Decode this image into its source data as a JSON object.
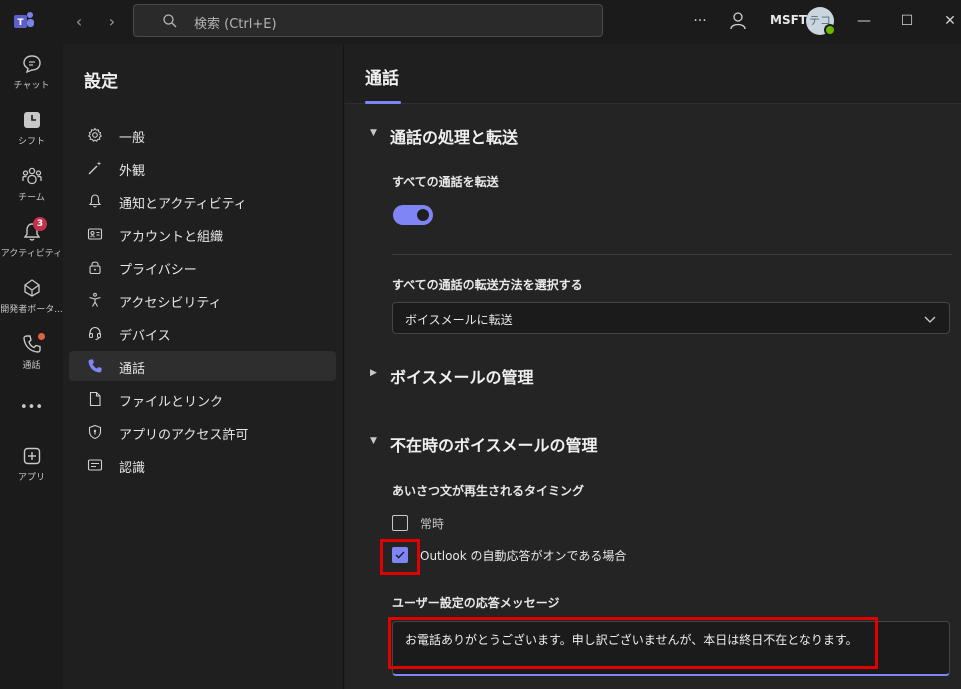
{
  "titlebar": {
    "search_placeholder": "検索 (Ctrl+E)",
    "org_name": "MSFT",
    "avatar_initials": "テコ",
    "more_icon": "ellipsis-icon",
    "minimize": "—",
    "maximize": "☐",
    "close": "✕"
  },
  "rail": {
    "items": [
      {
        "label": "チャット",
        "icon": "chat-icon"
      },
      {
        "label": "シフト",
        "icon": "shifts-icon"
      },
      {
        "label": "チーム",
        "icon": "teams-icon"
      },
      {
        "label": "アクティビティ",
        "icon": "bell-icon",
        "badge": "3"
      },
      {
        "label": "開発者ポータ...",
        "icon": "developer-portal-icon"
      },
      {
        "label": "通話",
        "icon": "phone-icon"
      },
      {
        "label": "•••",
        "icon": "more-apps-icon"
      },
      {
        "label": "アプリ",
        "icon": "add-apps-icon"
      }
    ]
  },
  "settings": {
    "title": "設定",
    "items": [
      {
        "label": "一般",
        "icon": "gear-icon"
      },
      {
        "label": "外観",
        "icon": "wand-icon"
      },
      {
        "label": "通知とアクティビティ",
        "icon": "bell-icon"
      },
      {
        "label": "アカウントと組織",
        "icon": "contact-card-icon"
      },
      {
        "label": "プライバシー",
        "icon": "lock-icon"
      },
      {
        "label": "アクセシビリティ",
        "icon": "accessibility-icon"
      },
      {
        "label": "デバイス",
        "icon": "headset-icon"
      },
      {
        "label": "通話",
        "icon": "phone-icon",
        "active": true
      },
      {
        "label": "ファイルとリンク",
        "icon": "document-icon"
      },
      {
        "label": "アプリのアクセス許可",
        "icon": "shield-icon"
      },
      {
        "label": "認識",
        "icon": "text-card-icon"
      }
    ]
  },
  "main": {
    "title": "通話",
    "section1": {
      "heading": "通話の処理と転送",
      "forward_all_label": "すべての通話を転送",
      "forward_all_on": true,
      "forward_method_label": "すべての通話の転送方法を選択する",
      "forward_method_value": "ボイスメールに転送"
    },
    "section2": {
      "heading": "ボイスメールの管理"
    },
    "section3": {
      "heading": "不在時のボイスメールの管理",
      "timing_label": "あいさつ文が再生されるタイミング",
      "option_always": "常時",
      "option_always_checked": false,
      "option_outlook": "Outlook の自動応答がオンである場合",
      "option_outlook_checked": true,
      "message_label": "ユーザー設定の応答メッセージ",
      "message_value": "お電話ありがとうございます。申し訳ございませんが、本日は終日不在となります。"
    }
  },
  "colors": {
    "accent": "#7f85f5",
    "highlight": "#e00000",
    "badge": "#c4314b"
  }
}
